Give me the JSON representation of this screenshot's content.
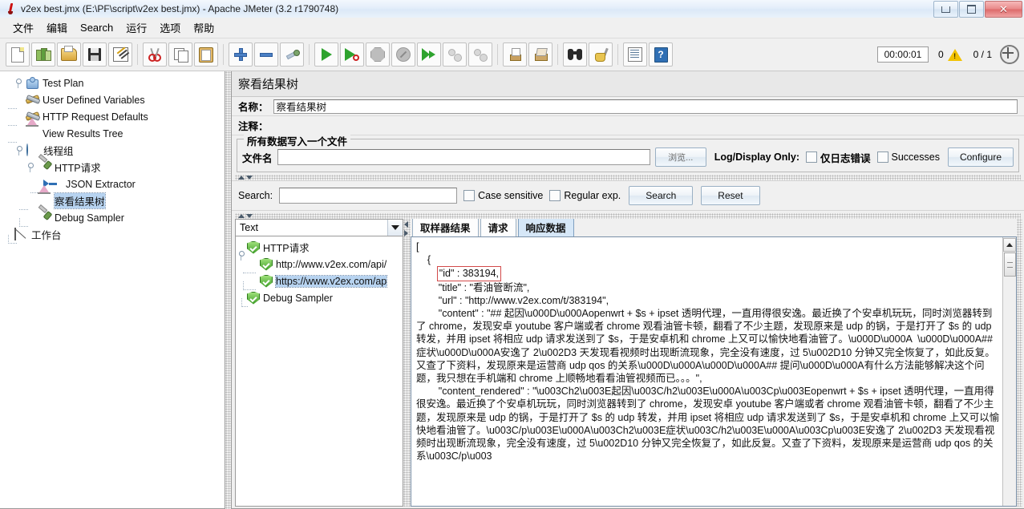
{
  "window": {
    "title": "v2ex best.jmx (E:\\PF\\script\\v2ex best.jmx) - Apache JMeter (3.2 r1790748)",
    "minimize_label": "–",
    "maximize_label": "□",
    "close_label": "✕"
  },
  "menu": {
    "items": [
      {
        "label": "文件",
        "name": "menu-file"
      },
      {
        "label": "编辑",
        "name": "menu-edit"
      },
      {
        "label": "Search",
        "name": "menu-search"
      },
      {
        "label": "运行",
        "name": "menu-run"
      },
      {
        "label": "选项",
        "name": "menu-options"
      },
      {
        "label": "帮助",
        "name": "menu-help"
      }
    ]
  },
  "toolbar": {
    "buttons": [
      {
        "name": "new-button",
        "icon": "new-document-icon"
      },
      {
        "name": "templates-button",
        "icon": "templates-icon"
      },
      {
        "name": "open-button",
        "icon": "open-folder-icon"
      },
      {
        "name": "save-button",
        "icon": "save-disk-icon"
      },
      {
        "name": "save-as-button",
        "icon": "save-as-icon"
      },
      {
        "name": "cut-button",
        "icon": "scissors-icon"
      },
      {
        "name": "copy-button",
        "icon": "copy-icon"
      },
      {
        "name": "paste-button",
        "icon": "clipboard-icon"
      },
      {
        "name": "expand-all-button",
        "icon": "plus-icon"
      },
      {
        "name": "collapse-all-button",
        "icon": "minus-icon"
      },
      {
        "name": "toggle-button",
        "icon": "toggle-icon"
      },
      {
        "name": "start-button",
        "icon": "play-icon"
      },
      {
        "name": "start-no-pauses-button",
        "icon": "play-no-pauses-icon"
      },
      {
        "name": "stop-button",
        "icon": "stop-icon"
      },
      {
        "name": "shutdown-button",
        "icon": "shutdown-icon"
      },
      {
        "name": "start-remote-all-button",
        "icon": "play-multiple-icon"
      },
      {
        "name": "stop-remote-all-button",
        "icon": "clear-circles-icon"
      },
      {
        "name": "shutdown-remote-all-button",
        "icon": "clear-circles-icon"
      },
      {
        "name": "clear-button",
        "icon": "brush-icon"
      },
      {
        "name": "clear-all-button",
        "icon": "brush-all-icon"
      },
      {
        "name": "search-button",
        "icon": "binoculars-icon"
      },
      {
        "name": "reset-search-button",
        "icon": "mop-icon"
      },
      {
        "name": "function-helper-button",
        "icon": "function-list-icon"
      },
      {
        "name": "help-button",
        "icon": "help-book-icon"
      }
    ],
    "status": {
      "elapsed": "00:00:01",
      "warnings": "0",
      "threads": "0 / 1"
    }
  },
  "tree": {
    "nodes": [
      {
        "label": "Test Plan",
        "icon": "test-plan-icon",
        "depth": 0,
        "expanded": true,
        "selected": false
      },
      {
        "label": "User Defined Variables",
        "icon": "wrench-icon",
        "depth": 1,
        "expanded": false,
        "selected": false
      },
      {
        "label": "HTTP Request Defaults",
        "icon": "wrench-icon",
        "depth": 1,
        "expanded": false,
        "selected": false
      },
      {
        "label": "View Results Tree",
        "icon": "view-results-tree-icon",
        "depth": 1,
        "expanded": false,
        "selected": false
      },
      {
        "label": "线程组",
        "icon": "thread-group-icon",
        "depth": 1,
        "expanded": true,
        "selected": false
      },
      {
        "label": "HTTP请求",
        "icon": "sampler-icon",
        "depth": 2,
        "expanded": true,
        "selected": false
      },
      {
        "label": "JSON Extractor",
        "icon": "post-processor-icon",
        "depth": 3,
        "expanded": false,
        "selected": false
      },
      {
        "label": "察看结果树",
        "icon": "view-results-tree-icon",
        "depth": 2,
        "expanded": false,
        "selected": true
      },
      {
        "label": "Debug Sampler",
        "icon": "sampler-icon",
        "depth": 2,
        "expanded": false,
        "selected": false
      },
      {
        "label": "工作台",
        "icon": "workbench-icon",
        "depth": 0,
        "expanded": false,
        "selected": false
      }
    ]
  },
  "panel": {
    "title": "察看结果树",
    "name_label": "名称：",
    "name_value": "察看结果树",
    "comment_label": "注释：",
    "comment_value": "",
    "filegroup_title": "所有数据写入一个文件",
    "filename_label": "文件名",
    "filename_value": "",
    "browse_label": "浏览...",
    "logdisplay_label": "Log/Display Only:",
    "errors_only_label": "仅日志错误",
    "successes_label": "Successes",
    "configure_label": "Configure"
  },
  "search": {
    "label": "Search:",
    "value": "",
    "case_sensitive_label": "Case sensitive",
    "regular_exp_label": "Regular exp.",
    "search_button": "Search",
    "reset_button": "Reset"
  },
  "results": {
    "render_selected": "Text",
    "nodes": [
      {
        "label": "HTTP请求",
        "depth": 0,
        "selected": false,
        "expanded": true
      },
      {
        "label": "http://www.v2ex.com/api/",
        "depth": 1,
        "selected": false,
        "expanded": false
      },
      {
        "label": "https://www.v2ex.com/ap",
        "depth": 1,
        "selected": true,
        "expanded": false
      },
      {
        "label": "Debug Sampler",
        "depth": 0,
        "selected": false,
        "expanded": false
      }
    ]
  },
  "view_tabs": [
    {
      "label": "取样器结果",
      "active": false,
      "name": "tab-sampler-result"
    },
    {
      "label": "请求",
      "active": false,
      "name": "tab-request"
    },
    {
      "label": "响应数据",
      "active": true,
      "name": "tab-response-data"
    }
  ],
  "response": {
    "line_open": "[",
    "line_brace": "    {",
    "highlight_id": "\"id\" : 383194,",
    "body": "        \"title\" : \"看油管断流\",\n        \"url\" : \"http://www.v2ex.com/t/383194\",\n        \"content\" : \"## 起因\\u000D\\u000Aopenwrt + $s + ipset 透明代理，一直用得很安逸。最近换了个安卓机玩玩，同时浏览器转到了 chrome，发现安卓 youtube 客户端或者 chrome 观看油管卡顿，翻看了不少主题，发现原来是 udp 的锅，于是打开了 $s 的 udp 转发，并用 ipset 将相应 udp 请求发送到了 $s，于是安卓机和 chrome 上又可以愉快地看油管了。\\u000D\\u000A  \\u000D\\u000A## 症状\\u000D\\u000A安逸了 2\\u002D3 天发现看视频时出现断流现象，完全没有速度，过 5\\u002D10 分钟又完全恢复了，如此反复。又查了下资料，发现原来是运营商 udp qos 的关系\\u000D\\u000A\\u000D\\u000A## 提问\\u000D\\u000A有什么方法能够解决这个问题，我只想在手机端和 chrome 上顺畅地看看油管视频而已。。。\",\n        \"content_rendered\" : \"\\u003Ch2\\u003E起因\\u003C/h2\\u003E\\u000A\\u003Cp\\u003Eopenwrt + $s + ipset 透明代理，一直用得很安逸。最近换了个安卓机玩玩，同时浏览器转到了 chrome，发现安卓 youtube 客户端或者 chrome 观看油管卡顿，翻看了不少主题，发现原来是 udp 的锅，于是打开了 $s 的 udp 转发，并用 ipset 将相应 udp 请求发送到了 $s，于是安卓机和 chrome 上又可以愉快地看油管了。\\u003C/p\\u003E\\u000A\\u003Ch2\\u003E症状\\u003C/h2\\u003E\\u000A\\u003Cp\\u003E安逸了 2\\u002D3 天发现看视频时出现断流现象，完全没有速度，过 5\\u002D10 分钟又完全恢复了，如此反复。又查了下资料，发现原来是运营商 udp qos 的关系\\u003C/p\\u003"
  }
}
